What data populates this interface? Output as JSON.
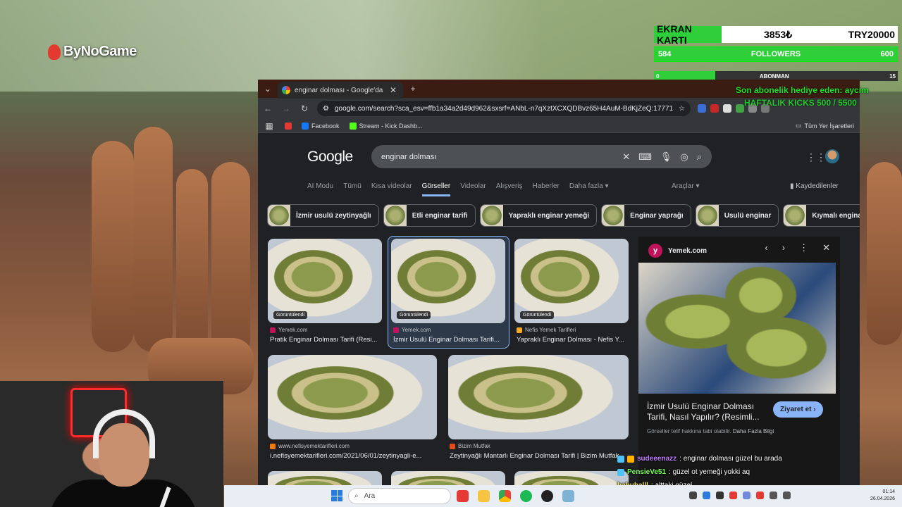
{
  "stream": {
    "logo": "ByNoGame",
    "ekran": {
      "label": "EKRAN KARTI",
      "amount": "3853₺",
      "goal": "TRY20000"
    },
    "followers": {
      "current": "584",
      "label": "FOLLOWERS",
      "goal": "600"
    },
    "abonman": {
      "current": "0",
      "label": "ABONMAN",
      "goal": "15",
      "fill_fraction": 0.25
    },
    "last_sub": "Son abonelik hediye eden: aycim",
    "kicks": "HAFTALIK KICKS 500 / 5500"
  },
  "browser": {
    "tab_title": "enginar dolması - Google'da Ara",
    "new_tab": "+",
    "url": "google.com/search?sca_esv=ffb1a34a2d49d962&sxsrf=ANbL-n7qXztXCXQDBvz65H4AuM-BdKjZeQ:17771552570650...",
    "bookmarks": [
      "Facebook",
      "Stream - Kick Dashb..."
    ],
    "all_bookmarks": "Tüm Yer İşaretleri"
  },
  "google": {
    "logo": "Google",
    "query": "enginar dolması",
    "nav": [
      "AI Modu",
      "Tümü",
      "Kısa videolar",
      "Görseller",
      "Videolar",
      "Alışveriş",
      "Haberler",
      "Daha fazla ▾"
    ],
    "active_nav": "Görseller",
    "tools": "Araçlar ▾",
    "saved": "Kaydedilenler",
    "chips": [
      "İzmir usulü zeytinyağlı",
      "Etli enginar tarifi",
      "Yapraklı enginar yemeği",
      "Enginar yaprağı",
      "Usulü enginar",
      "Kıymalı enginar"
    ],
    "results": [
      {
        "badge": "Görüntülendi",
        "source": "Yemek.com",
        "title": "Pratik Enginar Dolması Tarifi (Resi..."
      },
      {
        "badge": "Görüntülendi",
        "source": "Yemek.com",
        "title": "İzmir Usulü Enginar Dolması Tarifi..."
      },
      {
        "badge": "Görüntülendi",
        "source": "Nefis Yemek Tarifleri",
        "title": "Yapraklı Enginar Dolması - Nefis Y..."
      },
      {
        "source": "www.nefisyemektarifleri.com",
        "title": "i.nefisyemektarifleri.com/2021/06/01/zeytinyagli-e..."
      },
      {
        "source": "Bizim Mutfak",
        "title": "Zeytinyağlı Mantarlı Enginar Dolması Tarifi | Bizim Mutfak"
      }
    ],
    "panel": {
      "source": "Yemek.com",
      "title": "İzmir Usulü Enginar Dolması Tarifi, Nasıl Yapılır? (Resimli...",
      "visit": "Ziyaret et ›",
      "note": "Görseller telif hakkına tabi olabilir.",
      "more": "Daha Fazla Bilgi"
    }
  },
  "chat": [
    {
      "user": "sudeeenazz",
      "msg": ": enginar dolması güzel bu arada"
    },
    {
      "user": "PensieVe51",
      "msg": ": güzel ot yemeği yokki aq"
    },
    {
      "user": "babuballl",
      "msg": ": alttaki güzel"
    }
  ],
  "taskbar": {
    "search": "Ara",
    "time": "01:14",
    "date": "26.04.2026"
  }
}
